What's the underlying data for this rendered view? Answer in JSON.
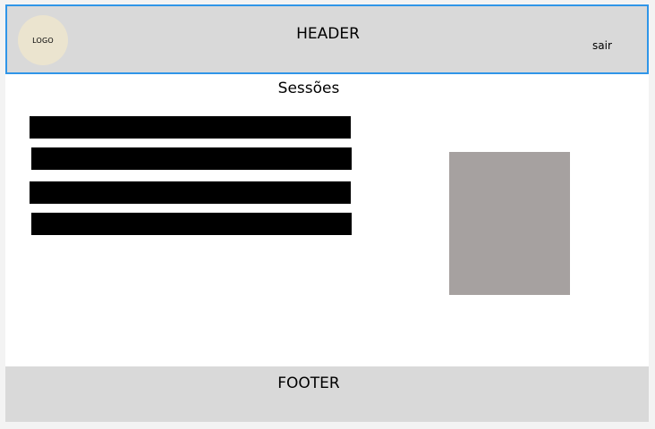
{
  "header": {
    "logo_text": "LOGO",
    "title": "HEADER",
    "logout_label": "sair"
  },
  "main": {
    "title": "Sessões",
    "sessions": [
      {
        "label": ""
      },
      {
        "label": ""
      },
      {
        "label": ""
      },
      {
        "label": ""
      }
    ]
  },
  "footer": {
    "title": "FOOTER"
  },
  "colors": {
    "page_background": "#f3f3f3",
    "frame_background": "#ffffff",
    "header_background": "#d9d9d9",
    "header_border": "#2f95e8",
    "logo_background": "#ebe4cf",
    "session_bar": "#000000",
    "image_placeholder": "#a6a1a0",
    "footer_background": "#d9d9d9"
  }
}
